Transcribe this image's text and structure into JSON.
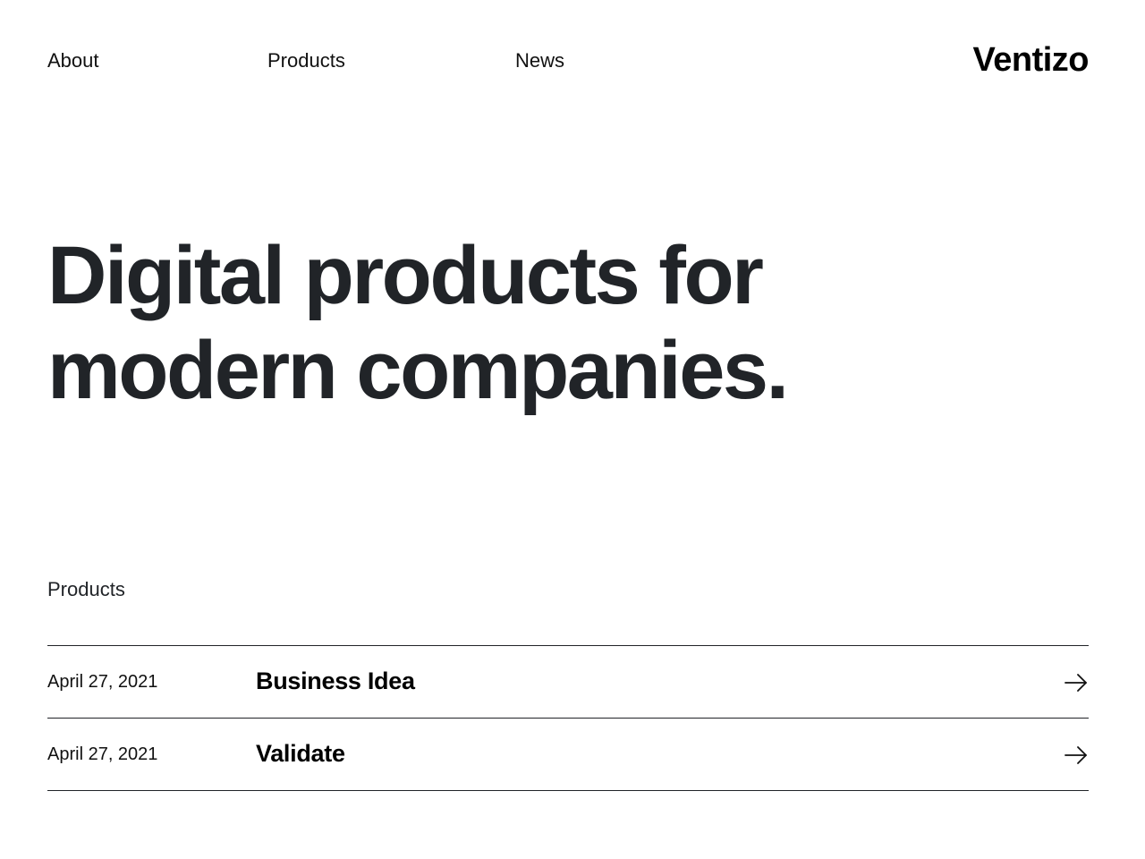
{
  "nav": {
    "links": [
      {
        "label": "About"
      },
      {
        "label": "Products"
      },
      {
        "label": "News"
      }
    ],
    "brand": "Ventizo"
  },
  "hero": {
    "line1": "Digital products for",
    "line2": "modern companies."
  },
  "products": {
    "section_label": "Products",
    "items": [
      {
        "date": "April 27, 2021",
        "title": "Business Idea",
        "icon": "arrow-right-icon"
      },
      {
        "date": "April 27, 2021",
        "title": "Validate",
        "icon": "arrow-right-icon"
      }
    ]
  },
  "colors": {
    "text": "#111111",
    "heading": "#212428",
    "divider": "#212428",
    "background": "#ffffff"
  }
}
